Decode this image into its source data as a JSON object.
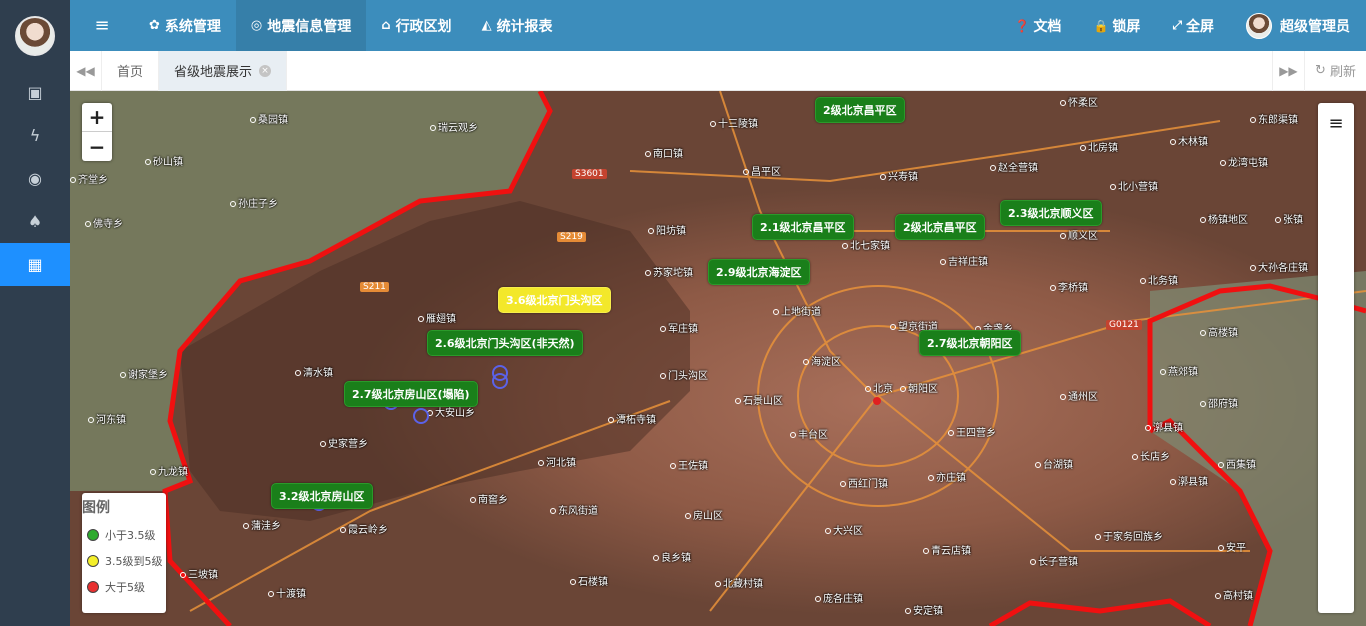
{
  "header": {
    "menu": [
      {
        "icon": "gear-icon",
        "label": "系统管理"
      },
      {
        "icon": "map-pin-icon",
        "label": "地震信息管理"
      },
      {
        "icon": "bank-icon",
        "label": "行政区划"
      },
      {
        "icon": "area-chart-icon",
        "label": "统计报表"
      }
    ],
    "docs": "文档",
    "lock": "锁屏",
    "fullscreen": "全屏",
    "user": "超级管理员"
  },
  "sidebar": {
    "icons": [
      "money-icon",
      "bolt-icon",
      "target-icon",
      "tree-icon",
      "grid-icon"
    ]
  },
  "tabs": {
    "home": "首页",
    "current": "省级地震展示",
    "refresh": "刷新"
  },
  "map": {
    "zoom_in": "+",
    "zoom_out": "−",
    "quakes": [
      {
        "label": "2级北京昌平区",
        "level": "green"
      },
      {
        "label": "2.1级北京昌平区",
        "level": "green"
      },
      {
        "label": "2级北京昌平区",
        "level": "green"
      },
      {
        "label": "2.3级北京顺义区",
        "level": "green"
      },
      {
        "label": "2.9级北京海淀区",
        "level": "green"
      },
      {
        "label": "3.6级北京门头沟区",
        "level": "yellow"
      },
      {
        "label": "2.6级北京门头沟区(非天然)",
        "level": "green"
      },
      {
        "label": "2.7级北京朝阳区",
        "level": "green"
      },
      {
        "label": "2.7级北京房山区(塌陷)",
        "level": "green"
      },
      {
        "label": "3.2级北京房山区",
        "level": "green"
      }
    ],
    "places": [
      "桑园镇",
      "瑞云观乡",
      "十三陵镇",
      "怀柔区",
      "南口镇",
      "昌平区",
      "北房镇",
      "东郎渠镇",
      "砂山镇",
      "兴寿镇",
      "赵全营镇",
      "木林镇",
      "龙湾屯镇",
      "齐堂乡",
      "北小营镇",
      "孙庄子乡",
      "阳坊镇",
      "北七家镇",
      "顺义区",
      "杨镇地区",
      "张镇",
      "佛寺乡",
      "苏家坨镇",
      "吉祥庄镇",
      "大孙各庄镇",
      "李桥镇",
      "北务镇",
      "雁翅镇",
      "军庄镇",
      "上地街道",
      "望京街道",
      "金盏乡",
      "高楼镇",
      "清水镇",
      "海淀区",
      "朝阳区",
      "燕郊镇",
      "谢家堡乡",
      "门头沟区",
      "北京",
      "通州区",
      "河东镇",
      "石景山区",
      "大安山乡",
      "潭柘寺镇",
      "丰台区",
      "王四营乡",
      "漷县镇",
      "邵府镇",
      "史家营乡",
      "台湖镇",
      "长店乡",
      "西集镇",
      "九龙镇",
      "河北镇",
      "王佐镇",
      "南窖乡",
      "西红门镇",
      "亦庄镇",
      "漷县镇",
      "东风街道",
      "房山区",
      "蒲洼乡",
      "霞云岭乡",
      "大兴区",
      "青云店镇",
      "长子营镇",
      "于家务回族乡",
      "安平",
      "良乡镇",
      "石楼镇",
      "北藏村镇",
      "十渡镇",
      "庞各庄镇",
      "安定镇",
      "高村镇",
      "三坡镇"
    ],
    "road_tags": [
      "S3601",
      "S219",
      "S211",
      "G0121"
    ]
  },
  "legend": {
    "title": "图例",
    "items": [
      {
        "label": "小于3.5级",
        "color": "#2eaa2e"
      },
      {
        "label": "3.5级到5级",
        "color": "#f4ef2a"
      },
      {
        "label": "大于5级",
        "color": "#e83030"
      }
    ]
  }
}
